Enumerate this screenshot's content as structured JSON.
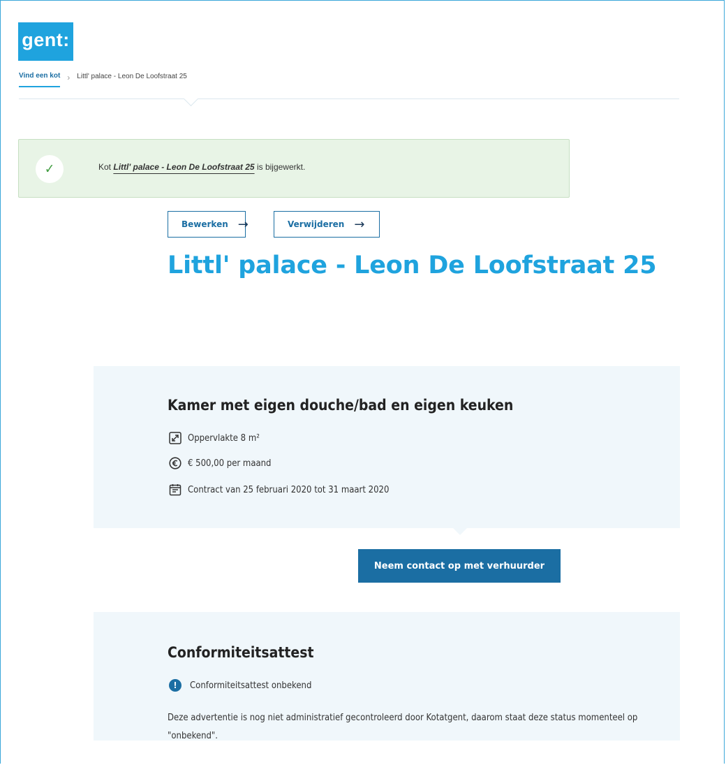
{
  "brand": {
    "logo_text": "gent:",
    "accent": "#1fa3de",
    "primary": "#1b6ea3"
  },
  "breadcrumb": {
    "link_label": "Vind een kot",
    "separator": "›",
    "current": "Littl' palace - Leon De Loofstraat 25"
  },
  "alert": {
    "icon": "check-icon",
    "prefix": "Kot",
    "link_text": "Littl' palace - Leon De Loofstraat 25",
    "suffix": "is bijgewerkt.",
    "background": "#e8f4e6"
  },
  "actions": {
    "edit_label": "Bewerken",
    "delete_label": "Verwijderen",
    "arrow": "→"
  },
  "listing": {
    "title": "Littl' palace - Leon De Loofstraat 25",
    "room_type": "Kamer met eigen douche/bad en eigen keuken",
    "features": [
      {
        "icon": "expand-arrows-icon",
        "text": "Oppervlakte 8 m²"
      },
      {
        "icon": "euro-icon",
        "text": "€ 500,00 per maand"
      },
      {
        "icon": "calendar-icon",
        "text": "Contract van 25 februari 2020 tot 31 maart 2020"
      }
    ],
    "contact_button": "Neem contact op met verhuurder"
  },
  "certificate": {
    "title": "Conformiteitsattest",
    "status_icon": "info-icon",
    "status": "Conformiteitsattest onbekend",
    "description": "Deze advertentie is nog niet administratief gecontroleerd door Kotatgent, daarom staat deze status momenteel op \"onbekend\"."
  }
}
